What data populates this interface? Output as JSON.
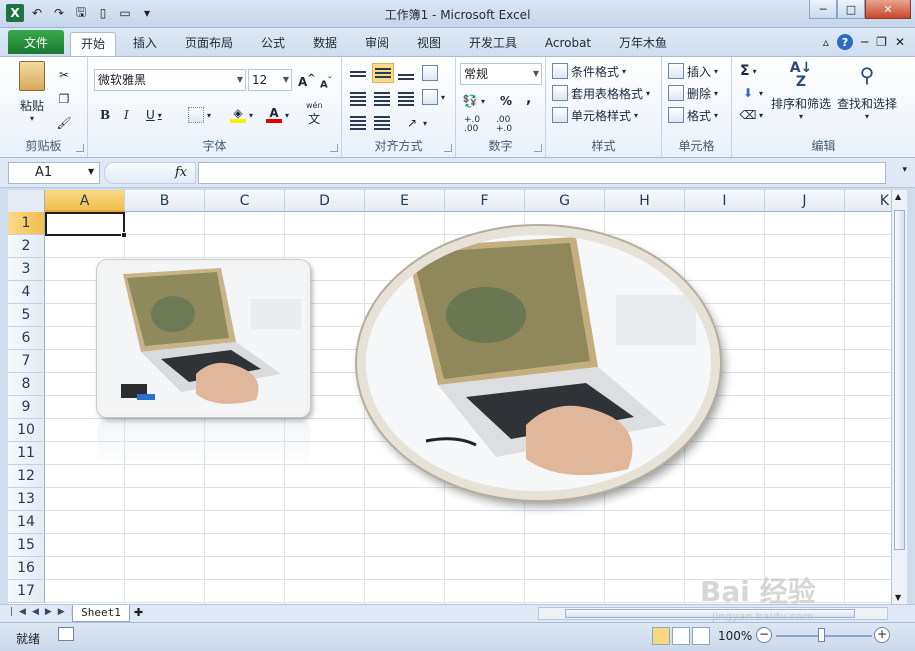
{
  "window": {
    "title": "工作簿1 - Microsoft Excel"
  },
  "tabs": {
    "file": "文件",
    "items": [
      "开始",
      "插入",
      "页面布局",
      "公式",
      "数据",
      "审阅",
      "视图",
      "开发工具",
      "Acrobat",
      "万年木鱼"
    ],
    "active": "开始"
  },
  "ribbon": {
    "clipboard": {
      "paste": "粘贴",
      "label": "剪贴板"
    },
    "font": {
      "name": "微软雅黑",
      "size": "12",
      "label": "字体",
      "phonetic": "wén"
    },
    "alignment": {
      "label": "对齐方式"
    },
    "number": {
      "format": "常规",
      "label": "数字",
      "percent": "%",
      "comma": ",",
      "inc_decimal": "+.0\n.00",
      "dec_decimal": ".00\n+.0"
    },
    "styles": {
      "conditional": "条件格式",
      "table": "套用表格格式",
      "cell": "单元格样式",
      "label": "样式"
    },
    "cells": {
      "insert": "插入",
      "delete": "删除",
      "format": "格式",
      "label": "单元格"
    },
    "editing": {
      "sum": "Σ",
      "sort": "排序和筛选",
      "find": "查找和选择",
      "label": "编辑"
    }
  },
  "formula_bar": {
    "namebox": "A1",
    "fx": "fx",
    "formula": ""
  },
  "grid": {
    "columns": [
      "A",
      "B",
      "C",
      "D",
      "E",
      "F",
      "G",
      "H",
      "I",
      "J",
      "K"
    ],
    "rows": [
      "1",
      "2",
      "3",
      "4",
      "5",
      "6",
      "7",
      "8",
      "9",
      "10",
      "11",
      "12",
      "13",
      "14",
      "15",
      "16",
      "17"
    ],
    "selected_cell": "A1"
  },
  "sheets": {
    "tabs": [
      "Sheet1"
    ]
  },
  "status": {
    "ready": "就绪",
    "zoom": "100%"
  },
  "watermark": {
    "brand": "Bai 经验",
    "url": "jingyan.baidu.com"
  }
}
